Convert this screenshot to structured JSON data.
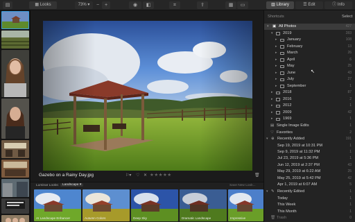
{
  "toolbar": {
    "looks_label": "Looks",
    "zoom": "73%",
    "minus": "−",
    "plus": "+",
    "tabs": [
      {
        "label": "Library"
      },
      {
        "label": "Edit"
      },
      {
        "label": "Info"
      }
    ]
  },
  "viewer": {
    "filename": "Gazebo on a Rainy Day.jpg",
    "rating_max": 5,
    "rating": 0
  },
  "looks": {
    "title": "Luminar Looks:",
    "category": "Landscape",
    "save_label": "Save New Look...",
    "cards": [
      {
        "label": "AI Landscape Enhancer"
      },
      {
        "label": "Autumn Colors"
      },
      {
        "label": "Deep Sky"
      },
      {
        "label": "Dramatic Landscape"
      },
      {
        "label": "Impressive"
      }
    ]
  },
  "panel": {
    "header": "Shortcuts",
    "select": "Select",
    "all_photos": {
      "label": "All Photos",
      "count": "427"
    },
    "year_2019": {
      "label": "2019",
      "count": "283"
    },
    "months": [
      {
        "label": "January",
        "count": "108"
      },
      {
        "label": "February",
        "count": "13"
      },
      {
        "label": "March",
        "count": "26"
      },
      {
        "label": "April",
        "count": "6"
      },
      {
        "label": "May",
        "count": "25"
      },
      {
        "label": "June",
        "count": "43"
      },
      {
        "label": "July",
        "count": "27"
      },
      {
        "label": "September",
        "count": "1"
      }
    ],
    "years": [
      {
        "label": "2018",
        "count": "87"
      },
      {
        "label": "2016",
        "count": "2"
      },
      {
        "label": "2012",
        "count": "1"
      },
      {
        "label": "2009",
        "count": "42"
      },
      {
        "label": "1969",
        "count": "1"
      }
    ],
    "single_edits": {
      "label": "Single Image Edits",
      "count": "1"
    },
    "favorites": {
      "label": "Favorites",
      "count": "2"
    },
    "recently_added": {
      "label": "Recently Added",
      "count": "191"
    },
    "added_dates": [
      {
        "label": "Sep 19, 2019 at 10:31 PM",
        "count": "1"
      },
      {
        "label": "Sep 9, 2019 at 11:32 PM",
        "count": "1"
      },
      {
        "label": "Jul 23, 2019 at 5:36 PM",
        "count": "1"
      },
      {
        "label": "Jun 12, 2019 at 2:37 PM",
        "count": "43"
      },
      {
        "label": "May 29, 2019 at 6:22 AM",
        "count": "25"
      },
      {
        "label": "May 25, 2019 at 5:42 PM",
        "count": "42"
      },
      {
        "label": "Apr 1, 2019 at 6:07 AM",
        "count": "5"
      }
    ],
    "recently_edited": {
      "label": "Recently Edited",
      "count": "1"
    },
    "edited": [
      {
        "label": "Today",
        "count": "1"
      },
      {
        "label": "This Week",
        "count": "1"
      },
      {
        "label": "This Month",
        "count": "1"
      }
    ],
    "trash": {
      "label": "Trash",
      "count": "0"
    }
  },
  "colors": {
    "accent": "#3a9bdc",
    "panel_bg": "#232323",
    "selected_row": "#3b3b3b"
  }
}
